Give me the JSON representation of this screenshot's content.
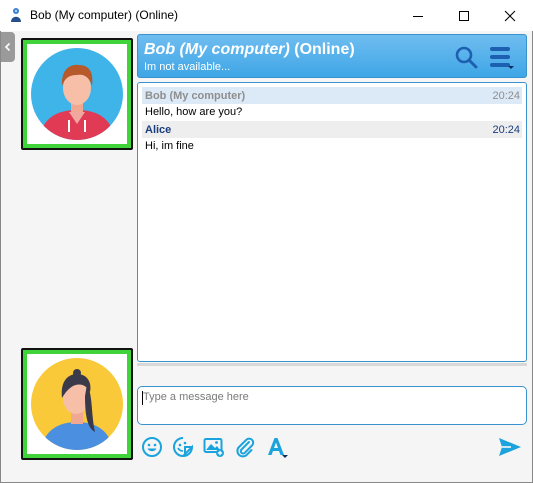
{
  "window": {
    "title": "Bob (My computer) (Online)",
    "controls": {
      "minimize_icon": "minimize-icon",
      "maximize_icon": "maximize-icon",
      "close_icon": "close-icon"
    }
  },
  "header": {
    "contact_name": "Bob (My computer)",
    "presence": "(Online)",
    "status_message": "Im not available..."
  },
  "messages": [
    {
      "sender": "Bob (My computer)",
      "time": "20:24",
      "text": "Hello, how are you?"
    },
    {
      "sender": "Alice",
      "time": "20:24",
      "text": "Hi, im fine"
    }
  ],
  "composer": {
    "placeholder": "Type a message here",
    "value": ""
  },
  "toolbar": {
    "icons": [
      "emoji-icon",
      "sticker-icon",
      "image-icon",
      "attach-icon",
      "font-icon",
      "send-icon"
    ]
  },
  "colors": {
    "header_top": "#6fbdf0",
    "header_bottom": "#3fa6e6",
    "accent": "#1aa3dd",
    "avatar_frame": "#74ee5a",
    "bob_row": "#dce9f6",
    "alice_name": "#1a3e7e"
  }
}
